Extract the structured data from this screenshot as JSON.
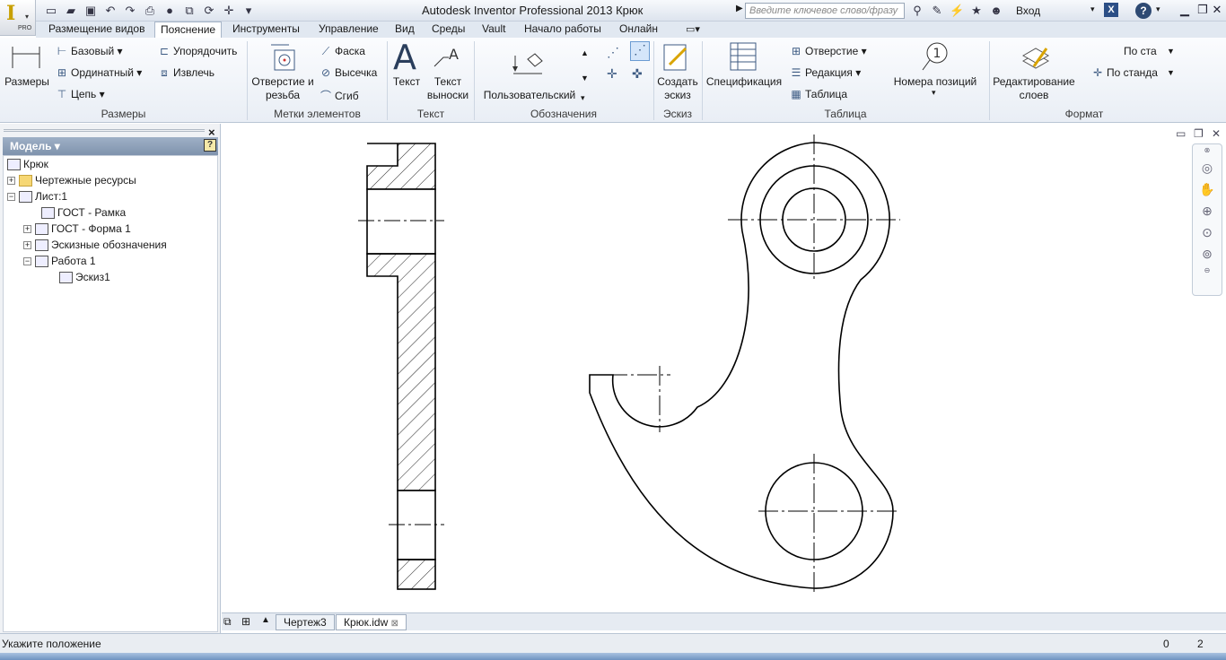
{
  "window": {
    "title": "Autodesk Inventor Professional 2013   Крюк",
    "search_placeholder": "Введите ключевое слово/фразу",
    "signin": "Вход",
    "app_badge": "PRO"
  },
  "menu": {
    "tabs": [
      "Размещение видов",
      "Пояснение",
      "Инструменты",
      "Управление",
      "Вид",
      "Среды",
      "Vault",
      "Начало работы",
      "Онлайн"
    ],
    "active_tab": "Пояснение"
  },
  "ribbon": {
    "dimensions": {
      "title": "Размеры",
      "big_label": "Размеры",
      "items": [
        "Базовый",
        "Ординатный",
        "Цепь",
        "Упорядочить",
        "Извлечь"
      ]
    },
    "feature_notes": {
      "title": "Метки элементов",
      "big_label_1": "Отверстие и",
      "big_label_2": "резьба",
      "items": [
        "Фаска",
        "Высечка",
        "Сгиб"
      ]
    },
    "text": {
      "title": "Текст",
      "text_label": "Текст",
      "leader_label_1": "Текст",
      "leader_label_2": "выноски"
    },
    "symbols": {
      "title": "Обозначения",
      "custom_label": "Пользовательский"
    },
    "sketch": {
      "title": "Эскиз",
      "label_1": "Создать",
      "label_2": "эскиз"
    },
    "table": {
      "title": "Таблица",
      "spec_label": "Спецификация",
      "items": [
        "Отверстие",
        "Редакция",
        "Таблица"
      ],
      "balloon_label": "Номера позиций",
      "balloon_number": "1"
    },
    "format": {
      "title": "Формат",
      "edit_label_1": "Редактирование",
      "edit_label_2": "слоев",
      "style_1": "По ста",
      "style_2": "По станда"
    }
  },
  "browser": {
    "header": "Модель",
    "tree": [
      {
        "label": "Крюк",
        "level": 0,
        "expander": ""
      },
      {
        "label": "Чертежные ресурсы",
        "level": 1,
        "expander": "+"
      },
      {
        "label": "Лист:1",
        "level": 1,
        "expander": "−"
      },
      {
        "label": "ГОСТ - Рамка",
        "level": 2,
        "expander": ""
      },
      {
        "label": "ГОСТ - Форма 1",
        "level": 2,
        "expander": "+"
      },
      {
        "label": "Эскизные обозначения",
        "level": 2,
        "expander": "+"
      },
      {
        "label": "Работа 1",
        "level": 2,
        "expander": "−"
      },
      {
        "label": "Эскиз1",
        "level": 3,
        "expander": ""
      }
    ]
  },
  "documents": {
    "tabs": [
      "Чертеж3",
      "Крюк.idw"
    ],
    "active": "Крюк.idw"
  },
  "status": {
    "prompt": "Укажите положение",
    "value_1": "0",
    "value_2": "2"
  },
  "colors": {
    "accent": "#3c5a82",
    "ribbon_bg": "#e9eef5",
    "canvas_bg": "#ffffff"
  }
}
